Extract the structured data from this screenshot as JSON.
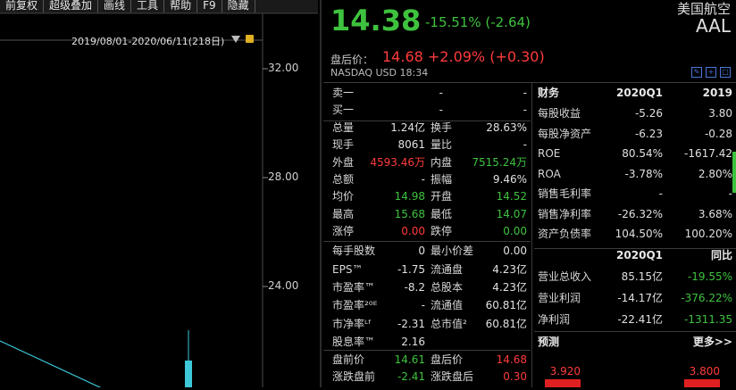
{
  "toolbar": {
    "items": [
      "前复权",
      "超级叠加",
      "画线",
      "工具",
      "帮助",
      "F9",
      "隐藏"
    ]
  },
  "chart": {
    "date_range": "2019/08/01-2020/06/11(218日)",
    "axis_ticks": [
      "32.00",
      "28.00",
      "24.00"
    ]
  },
  "quote": {
    "price": "14.38",
    "change": "-15.51% (-2.64)",
    "name": "美国航空",
    "code": "AAL",
    "after_hours_label": "盘后价：",
    "after_hours_value": "14.68 +2.09% (+0.30)",
    "exchange": "NASDAQ   USD   18:34"
  },
  "orderbook": [
    {
      "label": "卖一",
      "price": "-",
      "vol": "-"
    },
    {
      "label": "买一",
      "price": "-",
      "vol": "-"
    }
  ],
  "stats": [
    {
      "l1": "总量",
      "v1": "1.24亿",
      "c1": "w",
      "l2": "换手",
      "v2": "28.63%",
      "c2": "w"
    },
    {
      "l1": "现手",
      "v1": "8061",
      "c1": "w",
      "l2": "量比",
      "v2": "-",
      "c2": "w"
    },
    {
      "l1": "外盘",
      "v1": "4593.46万",
      "c1": "r",
      "l2": "内盘",
      "v2": "7515.24万",
      "c2": "g"
    },
    {
      "l1": "总额",
      "v1": "-",
      "c1": "w",
      "l2": "振幅",
      "v2": "9.46%",
      "c2": "w"
    },
    {
      "l1": "均价",
      "v1": "14.98",
      "c1": "g",
      "l2": "开盘",
      "v2": "14.52",
      "c2": "g"
    },
    {
      "l1": "最高",
      "v1": "15.68",
      "c1": "g",
      "l2": "最低",
      "v2": "14.07",
      "c2": "g"
    },
    {
      "l1": "涨停",
      "v1": "0.00",
      "c1": "r",
      "l2": "跌停",
      "v2": "0.00",
      "c2": "g"
    }
  ],
  "stats2": [
    {
      "l1": "每手股数",
      "v1": "0",
      "c1": "w",
      "l2": "最小价差",
      "v2": "0.00",
      "c2": "w"
    },
    {
      "l1": "EPS™",
      "v1": "-1.75",
      "c1": "w",
      "l2": "流通盘",
      "v2": "4.23亿",
      "c2": "w"
    },
    {
      "l1": "市盈率™",
      "v1": "-8.2",
      "c1": "w",
      "l2": "总股本",
      "v2": "4.23亿",
      "c2": "w"
    },
    {
      "l1": "市盈率²⁰ᴱ",
      "v1": "-",
      "c1": "w",
      "l2": "流通值",
      "v2": "60.81亿",
      "c2": "w"
    },
    {
      "l1": "市净率ᴸᶠ",
      "v1": "-2.31",
      "c1": "w",
      "l2": "总市值²",
      "v2": "60.81亿",
      "c2": "w"
    },
    {
      "l1": "股息率™",
      "v1": "2.16",
      "c1": "w",
      "l2": "",
      "v2": "",
      "c2": "w"
    }
  ],
  "stats3": [
    {
      "l1": "盘前价",
      "v1": "14.61",
      "c1": "g",
      "l2": "盘后价",
      "v2": "14.68",
      "c2": "r"
    },
    {
      "l1": "涨跌盘前",
      "v1": "-2.41",
      "c1": "g",
      "l2": "涨跌盘后",
      "v2": "0.30",
      "c2": "r"
    }
  ],
  "finance": {
    "header": {
      "title": "财务",
      "col1": "2020Q1",
      "col2": "2019"
    },
    "rows": [
      {
        "label": "每股收益",
        "v1": "-5.26",
        "c1": "w",
        "v2": "3.80",
        "c2": "w"
      },
      {
        "label": "每股净资产",
        "v1": "-6.23",
        "c1": "w",
        "v2": "-0.28",
        "c2": "w"
      },
      {
        "label": "ROE",
        "v1": "80.54%",
        "c1": "w",
        "v2": "-1617.42",
        "c2": "w"
      },
      {
        "label": "ROA",
        "v1": "-3.78%",
        "c1": "w",
        "v2": "2.80%",
        "c2": "w"
      },
      {
        "label": "销售毛利率",
        "v1": "-",
        "c1": "w",
        "v2": "-",
        "c2": "w"
      },
      {
        "label": "销售净利率",
        "v1": "-26.32%",
        "c1": "w",
        "v2": "3.68%",
        "c2": "w"
      },
      {
        "label": "资产负债率",
        "v1": "104.50%",
        "c1": "w",
        "v2": "100.20%",
        "c2": "w"
      }
    ],
    "header2": {
      "col1": "2020Q1",
      "col2": "同比"
    },
    "rows2": [
      {
        "label": "营业总收入",
        "v1": "85.15亿",
        "c1": "w",
        "v2": "-19.55%",
        "c2": "g"
      },
      {
        "label": "营业利润",
        "v1": "-14.17亿",
        "c1": "w",
        "v2": "-376.22%",
        "c2": "g"
      },
      {
        "label": "净利润",
        "v1": "-22.41亿",
        "c1": "w",
        "v2": "-1311.35",
        "c2": "g"
      }
    ],
    "forecast_title": "预测",
    "more": "更多>>",
    "forecast_values": [
      "3.920",
      "3.800"
    ]
  },
  "colors": {
    "up": "#ff3b3b",
    "down": "#3ec23e",
    "bg": "#000000",
    "accent": "#4a78d8"
  }
}
